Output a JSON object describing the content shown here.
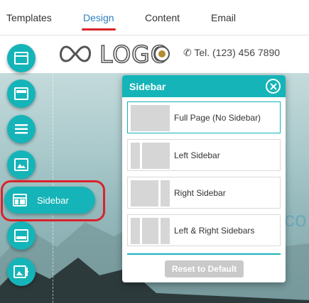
{
  "tabs": [
    {
      "label": "Templates"
    },
    {
      "label": "Design"
    },
    {
      "label": "Content"
    },
    {
      "label": "Email"
    }
  ],
  "active_tab": "Design",
  "site": {
    "logo_text": "LOGO",
    "phone": "Tel. (123) 456 7890",
    "hero_fragment": "co"
  },
  "rail": {
    "active_label": "Sidebar",
    "buttons": [
      "window-icon",
      "browser-icon",
      "menu-icon",
      "image-icon",
      "sidebar-icon",
      "browser-icon",
      "image-edit-icon"
    ]
  },
  "panel": {
    "title": "Sidebar",
    "options": [
      {
        "label": "Full Page (No Sidebar)",
        "selected": true
      },
      {
        "label": "Left Sidebar",
        "selected": false
      },
      {
        "label": "Right Sidebar",
        "selected": false
      },
      {
        "label": "Left & Right Sidebars",
        "selected": false
      }
    ],
    "reset_label": "Reset to Default"
  },
  "colors": {
    "accent": "#15b4b8",
    "active_tab": "#2f7fc1",
    "highlight": "#d9232a"
  }
}
